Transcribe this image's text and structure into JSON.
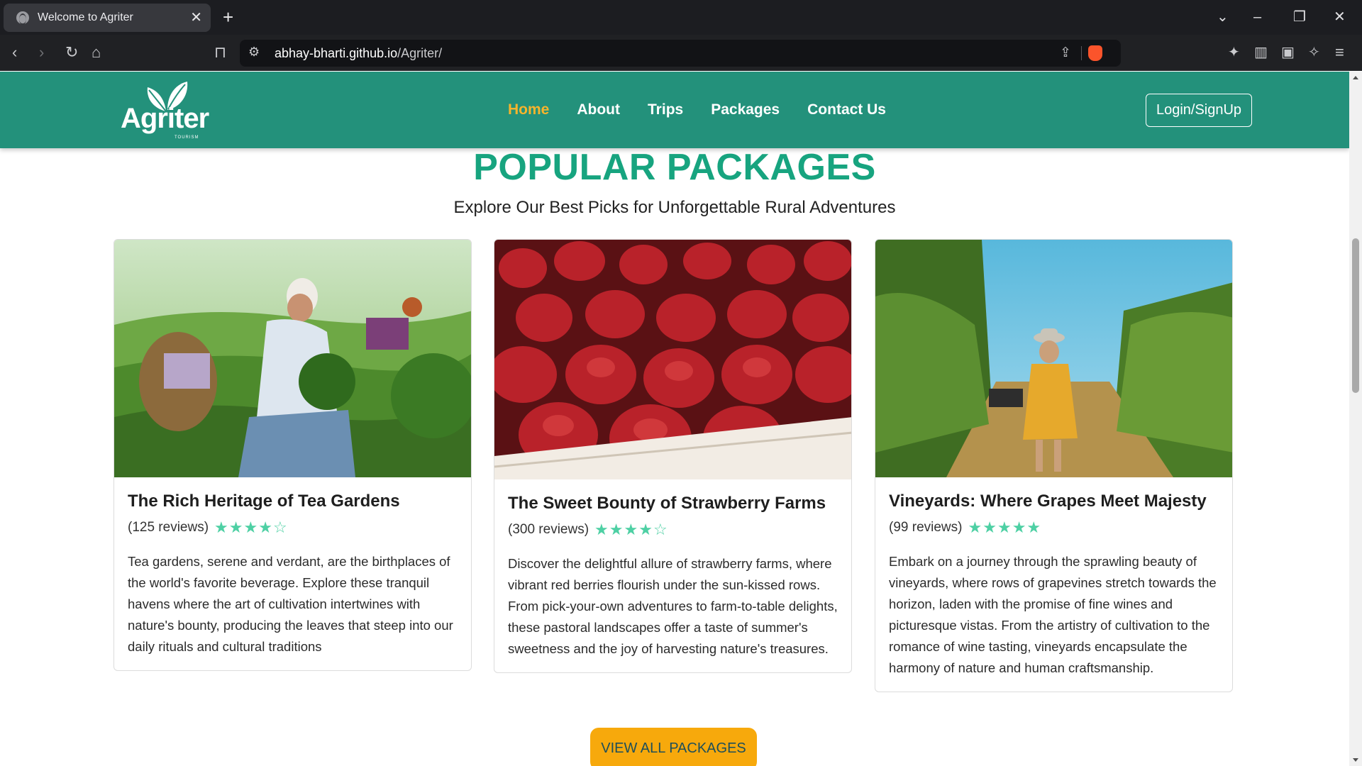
{
  "browser": {
    "tab_title": "Welcome to Agriter",
    "tab_close": "✕",
    "new_tab": "+",
    "url_host": "abhay-bharti.github.io",
    "url_path": "/Agriter/",
    "icons": [
      "globe-icon",
      "back-icon",
      "forward-icon",
      "reload-icon",
      "home-icon",
      "bookmark-icon",
      "site-settings-icon",
      "share-icon",
      "brave-shields-icon",
      "extensions-icon",
      "sidebar-icon",
      "wallet-icon",
      "leo-ai-icon",
      "menu-icon",
      "tab-search-icon",
      "minimize-icon",
      "restore-icon",
      "close-window-icon"
    ]
  },
  "site": {
    "logo_text": "Agriter",
    "logo_sub": "TOURISM",
    "nav": {
      "home": "Home",
      "about": "About",
      "trips": "Trips",
      "packages": "Packages",
      "contact": "Contact Us"
    },
    "login": "Login/SignUp",
    "colors": {
      "nav_bg": "#23917b",
      "active": "#f7b42c",
      "title": "#17a47f",
      "stars": "#4ed0a4",
      "cta": "#f7a90c"
    }
  },
  "section": {
    "title": "POPULAR PACKAGES",
    "subtitle": "Explore Our Best Picks for Unforgettable Rural Adventures"
  },
  "cards": [
    {
      "title": "The Rich Heritage of Tea Gardens",
      "reviews": "(125 reviews)",
      "rating": 4,
      "desc": "Tea gardens, serene and verdant, are the birthplaces of the world's favorite beverage. Explore these tranquil havens where the art of cultivation intertwines with nature's bounty, producing the leaves that steep into our daily rituals and cultural traditions"
    },
    {
      "title": "The Sweet Bounty of Strawberry Farms",
      "reviews": "(300 reviews)",
      "rating": 4,
      "desc": "Discover the delightful allure of strawberry farms, where vibrant red berries flourish under the sun-kissed rows. From pick-your-own adventures to farm-to-table delights, these pastoral landscapes offer a taste of summer's sweetness and the joy of harvesting nature's treasures."
    },
    {
      "title": "Vineyards: Where Grapes Meet Majesty",
      "reviews": "(99 reviews)",
      "rating": 5,
      "desc": "Embark on a journey through the sprawling beauty of vineyards, where rows of grapevines stretch towards the horizon, laden with the promise of fine wines and picturesque vistas. From the artistry of cultivation to the romance of wine tasting, vineyards encapsulate the harmony of nature and human craftsmanship."
    }
  ],
  "cta": "VIEW ALL PACKAGES"
}
